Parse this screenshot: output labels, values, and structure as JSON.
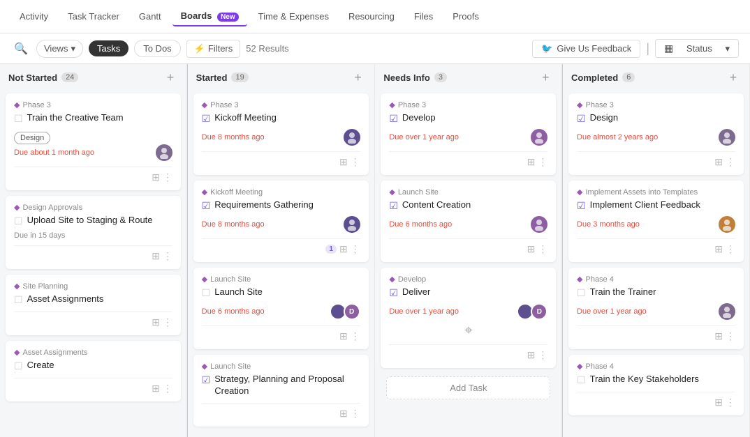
{
  "nav": {
    "items": [
      {
        "label": "Activity",
        "active": false
      },
      {
        "label": "Task Tracker",
        "active": false
      },
      {
        "label": "Gantt",
        "active": false
      },
      {
        "label": "Boards",
        "active": true,
        "badge": "New"
      },
      {
        "label": "Time & Expenses",
        "active": false
      },
      {
        "label": "Resourcing",
        "active": false
      },
      {
        "label": "Files",
        "active": false
      },
      {
        "label": "Proofs",
        "active": false
      }
    ]
  },
  "toolbar": {
    "views_label": "Views",
    "tasks_label": "Tasks",
    "todos_label": "To Dos",
    "filters_label": "Filters",
    "results": "52 Results",
    "feedback_label": "Give Us Feedback",
    "status_label": "Status"
  },
  "columns": [
    {
      "id": "not-started",
      "title": "Not Started",
      "count": "24",
      "cards": [
        {
          "phase": "Phase 3",
          "title": "Train the Creative Team",
          "due": "Due about 1 month ago",
          "due_class": "overdue",
          "avatar": "👤",
          "avatar_bg": "#7d6b8f",
          "tag": "Design",
          "sub_tasks": [],
          "check_done": false
        },
        {
          "phase": "Design Approvals",
          "title": "Upload Site to Staging & Route",
          "due": "Due in 15 days",
          "due_class": "",
          "avatar": null,
          "avatar_bg": "",
          "tag": null,
          "sub_tasks": [],
          "check_done": false,
          "parent_label": "Design Approvals"
        },
        {
          "phase": "Site Planning",
          "title": "Asset Assignments",
          "due": "",
          "due_class": "",
          "avatar": null,
          "avatar_bg": "",
          "tag": null,
          "sub_tasks": [],
          "check_done": false
        },
        {
          "phase": "Asset Assignments",
          "title": "Create",
          "due": "",
          "due_class": "",
          "avatar": null,
          "avatar_bg": "",
          "tag": null,
          "sub_tasks": [],
          "check_done": false
        }
      ]
    },
    {
      "id": "started",
      "title": "Started",
      "count": "19",
      "cards": [
        {
          "phase": "Phase 3",
          "title": "Kickoff Meeting",
          "due": "Due 8 months ago",
          "due_class": "overdue",
          "avatar": "👤",
          "avatar_bg": "#5d4e8f",
          "tag": null,
          "sub_tasks": [],
          "check_done": true
        },
        {
          "phase": "Kickoff Meeting",
          "title": "Requirements Gathering",
          "due": "Due 8 months ago",
          "due_class": "overdue",
          "avatar": "👤",
          "avatar_bg": "#5d4e8f",
          "tag": null,
          "sub_tasks": [],
          "check_done": true,
          "badge": "1"
        },
        {
          "phase": "Launch Site",
          "title": "Launch Site",
          "due": "Due 6 months ago",
          "due_class": "overdue",
          "avatar_multi": true,
          "tag": null,
          "sub_tasks": [],
          "check_done": false
        },
        {
          "phase": "Launch Site",
          "title": "Strategy, Planning and Proposal Creation",
          "due": "",
          "due_class": "",
          "avatar": null,
          "tag": null,
          "sub_tasks": [],
          "check_done": true
        }
      ]
    },
    {
      "id": "needs-info",
      "title": "Needs Info",
      "count": "3",
      "cards": [
        {
          "phase": "Phase 3",
          "title": "Develop",
          "due": "Due over 1 year ago",
          "due_class": "overdue",
          "avatar": "👤",
          "avatar_bg": "#8e5ea2",
          "tag": null,
          "sub_tasks": [],
          "check_done": true
        },
        {
          "phase": "Launch Site",
          "title": "Content Creation",
          "due": "Due 6 months ago",
          "due_class": "overdue",
          "avatar": "👤",
          "avatar_bg": "#8e5ea2",
          "tag": null,
          "sub_tasks": [],
          "check_done": true
        },
        {
          "phase": "Develop",
          "title": "Deliver",
          "due": "Due over 1 year ago",
          "due_class": "overdue",
          "avatar_multi": true,
          "tag": null,
          "sub_tasks": [],
          "check_done": true,
          "has_cursor": true
        }
      ],
      "add_task": "Add Task"
    },
    {
      "id": "completed",
      "title": "Completed",
      "count": "6",
      "cards": [
        {
          "phase": "Phase 3",
          "title": "Design",
          "due": "Due almost 2 years ago",
          "due_class": "overdue",
          "avatar": "👤",
          "avatar_bg": "#7d6b8f",
          "tag": null,
          "sub_tasks": [],
          "check_done": true
        },
        {
          "phase": "Implement Assets into Templates",
          "title": "Implement Client Feedback",
          "due": "Due 3 months ago",
          "due_class": "overdue",
          "avatar": "👤",
          "avatar_bg": "#c0803a",
          "tag": null,
          "sub_tasks": [],
          "check_done": true
        },
        {
          "phase": "Phase 4",
          "title": "Train the Trainer",
          "due": "Due over 1 year ago",
          "due_class": "overdue",
          "avatar": "👤",
          "avatar_bg": "#7d6b8f",
          "tag": null,
          "sub_tasks": [],
          "check_done": false
        },
        {
          "phase": "Phase 4",
          "title": "Train the Key Stakeholders",
          "due": "",
          "due_class": "",
          "avatar": null,
          "tag": null,
          "sub_tasks": [],
          "check_done": false
        }
      ]
    }
  ]
}
